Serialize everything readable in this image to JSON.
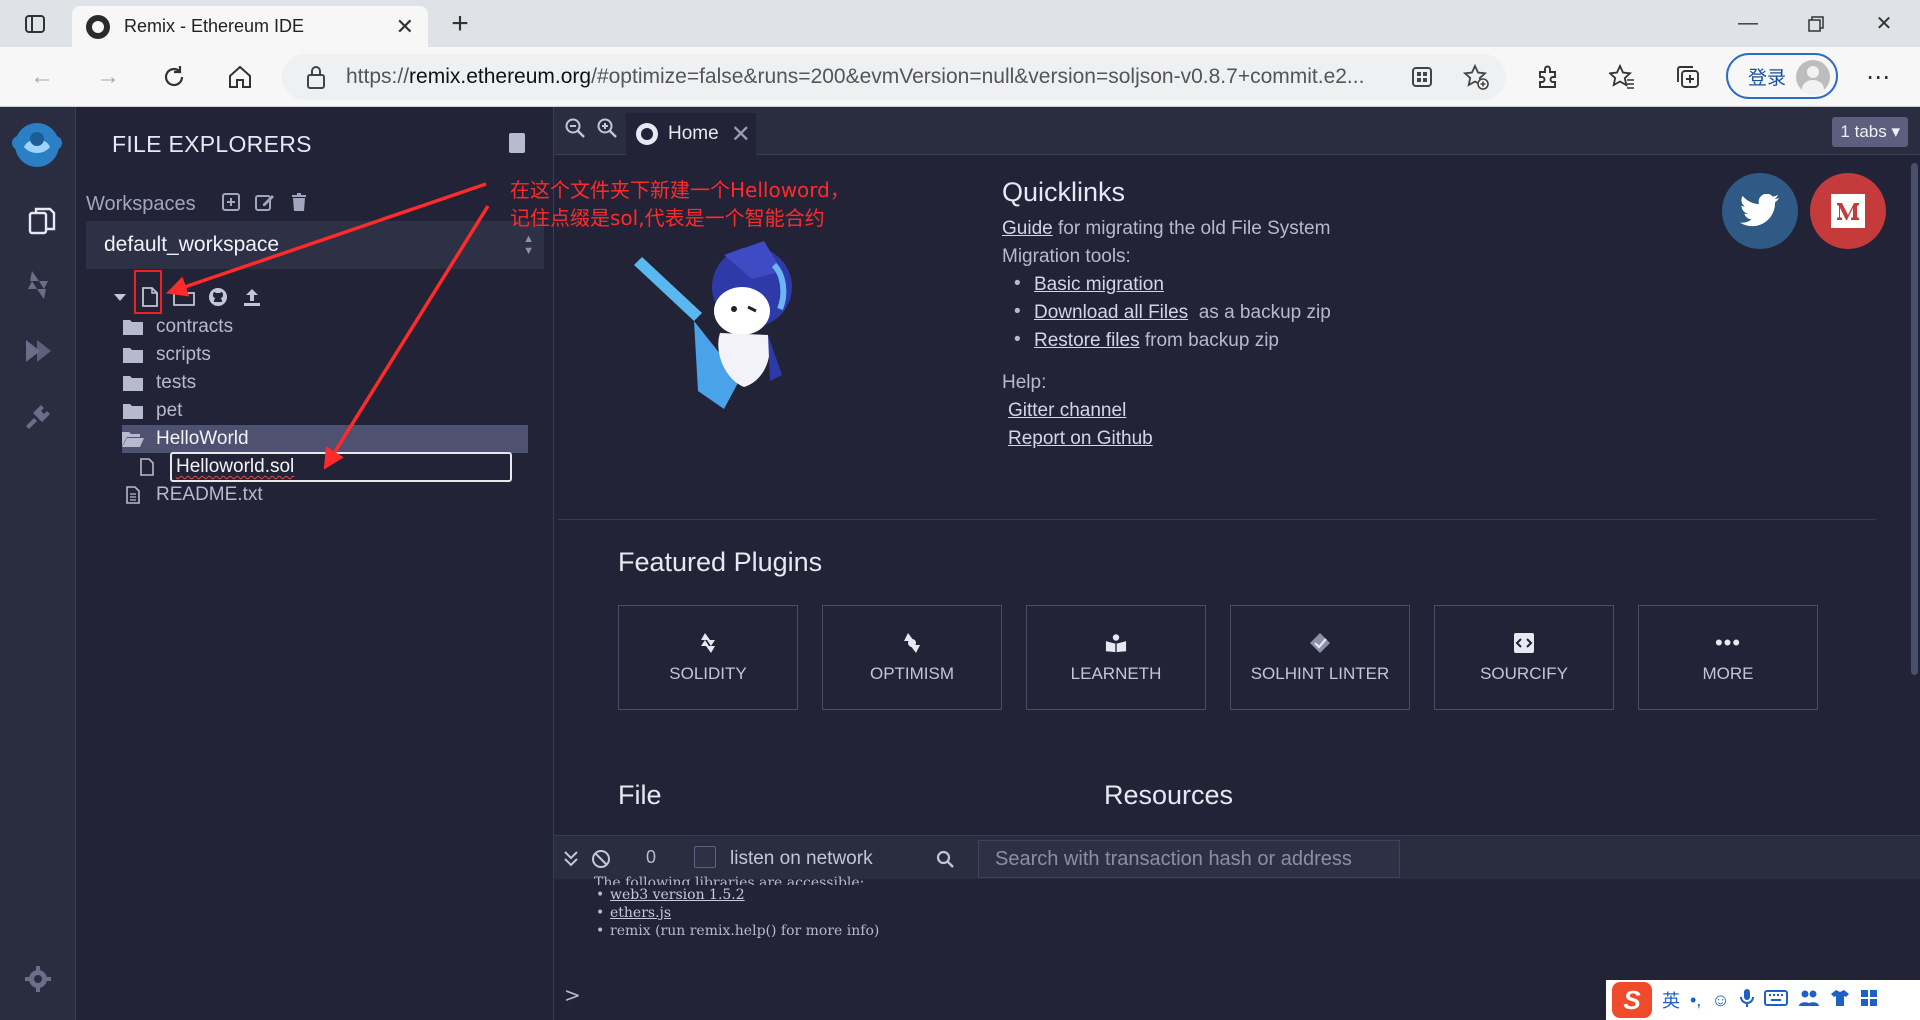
{
  "browser": {
    "tab_title": "Remix - Ethereum IDE",
    "url_prefix": "https://",
    "url_host": "remix.ethereum.org",
    "url_rest": "/#optimize=false&runs=200&evmVersion=null&version=soljson-v0.8.7+commit.e2...",
    "login_label": "登录"
  },
  "sidebar": {
    "title": "FILE EXPLORERS",
    "workspaces_label": "Workspaces",
    "workspace_selected": "default_workspace",
    "files": [
      {
        "name": "contracts",
        "type": "folder"
      },
      {
        "name": "scripts",
        "type": "folder"
      },
      {
        "name": "tests",
        "type": "folder"
      },
      {
        "name": "pet",
        "type": "folder"
      },
      {
        "name": "HelloWorld",
        "type": "folder-open"
      },
      {
        "name": "Helloworld.sol",
        "type": "file-editing"
      },
      {
        "name": "README.txt",
        "type": "text-file"
      }
    ]
  },
  "annotation": {
    "line1": "在这个文件夹下新建一个Helloword，",
    "line2": "记住点缀是sol,代表是一个智能合约",
    "color": "#ff2b2b"
  },
  "main": {
    "home_tab": "Home",
    "tabs_count": "1 tabs",
    "quicklinks": {
      "title": "Quicklinks",
      "guide_link": "Guide",
      "guide_text": " for migrating the old File System",
      "migration_label": "Migration tools:",
      "items": [
        {
          "link": "Basic migration",
          "text": ""
        },
        {
          "link": "Download all Files",
          "text": "  as a backup zip"
        },
        {
          "link": "Restore files",
          "text": " from backup zip"
        }
      ],
      "help_label": "Help:",
      "help_links": [
        "Gitter channel",
        "Report on Github"
      ]
    },
    "featured_title": "Featured Plugins",
    "plugins": [
      "SOLIDITY",
      "OPTIMISM",
      "LEARNETH",
      "SOLHINT LINTER",
      "SOURCIFY",
      "MORE"
    ],
    "section_file": "File",
    "section_resources": "Resources"
  },
  "terminal": {
    "count": "0",
    "listen_label": "listen on network",
    "search_placeholder": "Search with transaction hash or address",
    "cut_line": "The following libraries are accessible:",
    "libs": [
      {
        "link": "web3 version 1.5.2",
        "text": ""
      },
      {
        "link": "ethers.js",
        "text": ""
      },
      {
        "link": "",
        "text": "remix (run remix.help() for more info)"
      }
    ],
    "prompt": ">"
  },
  "ime": {
    "lang": "英",
    "punct": "•,"
  },
  "colors": {
    "bg": "#222336",
    "panel": "#2a2c3f",
    "accent": "#2c6cc8",
    "twitter": "#2f5a86",
    "medium": "#c53a3a"
  }
}
